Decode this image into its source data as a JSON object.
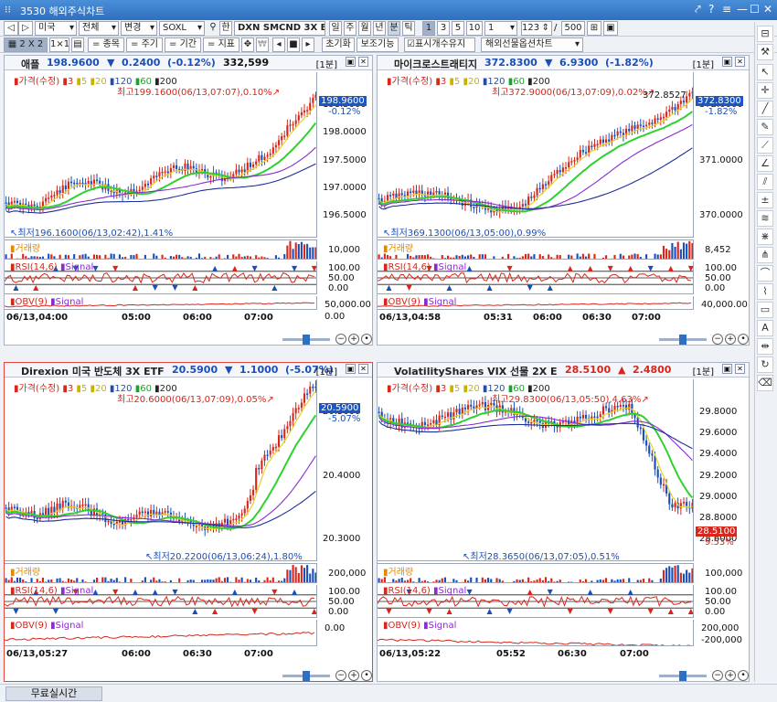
{
  "window": {
    "title": "3530 해외주식차트",
    "icons": [
      "link-icon",
      "help-icon",
      "menu-icon",
      "minimize-icon",
      "maximize-icon",
      "close-icon"
    ]
  },
  "toolbar1": {
    "market": "미국",
    "filter": "전체",
    "change": "변경",
    "symbol": "SOXL",
    "han": "한",
    "codes": "DXN SMCND 3X BL",
    "periods": [
      "일",
      "주",
      "월",
      "년",
      "분",
      "틱"
    ],
    "numbers": [
      "1",
      "3",
      "5",
      "10"
    ],
    "interval": "1",
    "count": "123",
    "slash": "/",
    "max": "500"
  },
  "toolbar2": {
    "layout": "2 X 2",
    "one": "1×1",
    "menus": [
      "= 종목",
      "= 주기",
      "= 기간",
      "= 지표"
    ],
    "reset": "초기화",
    "assist": "보조기능",
    "showcount": "표시개수유지",
    "futures": "해외선물옵션차트"
  },
  "panels": [
    {
      "name": "애플",
      "price": "198.9600",
      "arrow": "▼",
      "change": "0.2400",
      "pct": "(-0.12%)",
      "volume": "332,599",
      "interval": "[1분]",
      "direction": "down",
      "legend": {
        "price": "가격(수정)",
        "m3": "3",
        "m5": "5",
        "m20": "20",
        "m120": "120",
        "m60": "60",
        "m200": "200"
      },
      "high": "최고199.1600(06/13,07:07),0.10%",
      "low": "최저196.1600(06/13,02:42),1.41%",
      "ticks": [
        "198.5000",
        "198.0000",
        "197.5000",
        "197.0000",
        "196.5000"
      ],
      "tag": "198.9600",
      "tagpct": "-0.12%",
      "volume_label": "거래량",
      "volume_tick": "10,000",
      "rsi_label": "RSI(14,6)",
      "signal": "Signal",
      "rsi_ticks": [
        "100.00",
        "50.00",
        "0.00"
      ],
      "obv_label": "OBV(9)",
      "obv_ticks": [
        "50,000.00",
        "0.00"
      ],
      "xticks": [
        "06/13,04:00",
        "05:00",
        "06:00",
        "07:00"
      ]
    },
    {
      "name": "마이크로스트래티지",
      "price": "372.8300",
      "arrow": "▼",
      "change": "6.9300",
      "pct": "(-1.82%)",
      "volume": "",
      "interval": "[1분]",
      "direction": "down",
      "legend": {
        "price": "가격(수정)",
        "m3": "3",
        "m5": "5",
        "m20": "20",
        "m120": "120",
        "m60": "60",
        "m200": "200"
      },
      "high": "최고372.9000(06/13,07:09),0.02%",
      "low": "최저369.1300(06/13,05:00),0.99%",
      "lastlabel": "372.8527",
      "ticks": [
        "372.0000",
        "371.0000",
        "370.0000"
      ],
      "tag": "372.8300",
      "tagpct": "-1.82%",
      "volume_label": "거래량",
      "volume_tick": "8,452",
      "rsi_label": "RSI(14,6)",
      "signal": "Signal",
      "rsi_ticks": [
        "100.00",
        "50.00",
        "0.00"
      ],
      "obv_label": "OBV(9)",
      "obv_ticks": [
        "40,000.00"
      ],
      "xticks": [
        "06/13,04:58",
        "05:31",
        "06:00",
        "06:30",
        "07:00"
      ]
    },
    {
      "name": "Direxion 미국 반도체 3X ETF",
      "price": "20.5900",
      "arrow": "▼",
      "change": "1.1000",
      "pct": "(-5.07%)",
      "volume": "",
      "interval": "[1분]",
      "direction": "down",
      "legend": {
        "price": "가격(수정)",
        "m3": "3",
        "m5": "5",
        "m20": "20",
        "m120": "120",
        "m60": "60",
        "m200": "200"
      },
      "high": "최고20.6000(06/13,07:09),0.05%",
      "low": "최저20.2200(06/13,06:24),1.80%",
      "ticks": [
        "20.5000",
        "20.4000",
        "20.3000"
      ],
      "tag": "20.5900",
      "tagpct": "-5.07%",
      "volume_label": "거래량",
      "volume_tick": "200,000",
      "rsi_label": "RSI(14,6)",
      "signal": "Signal",
      "rsi_ticks": [
        "100.00",
        "50.00",
        "0.00"
      ],
      "obv_label": "OBV(9)",
      "obv_ticks": [
        "0.00"
      ],
      "xticks": [
        "06/13,05:27",
        "06:00",
        "06:30",
        "07:00"
      ]
    },
    {
      "name": "VolatilityShares VIX 선물 2X E",
      "price": "28.5100",
      "arrow": "▲",
      "change": "2.4800",
      "pct": "",
      "volume": "",
      "interval": "[1분]",
      "direction": "up",
      "legend": {
        "price": "가격(수정)",
        "m3": "3",
        "m5": "5",
        "m20": "20",
        "m120": "120",
        "m60": "60",
        "m200": "200"
      },
      "high": "최고29.8300(06/13,05:50),4.63%",
      "low": "최저28.3650(06/13,07:05),0.51%",
      "ticks": [
        "29.8000",
        "29.6000",
        "29.4000",
        "29.2000",
        "29.0000",
        "28.8000",
        "28.6000"
      ],
      "tag": "28.5100",
      "tagpct": "9.53%",
      "volume_label": "거래량",
      "volume_tick": "100,000",
      "rsi_label": "RSI(14,6)",
      "signal": "Signal",
      "rsi_ticks": [
        "100.00",
        "50.00",
        "0.00"
      ],
      "obv_label": "OBV(9)",
      "obv_ticks": [
        "200,000",
        "-200,000"
      ],
      "xticks": [
        "06/13,05:22",
        "05:52",
        "06:30",
        "07:00"
      ]
    }
  ],
  "statusbar": {
    "tab": "무료실시간"
  },
  "colors": {
    "up": "#d8261b",
    "down": "#1a4fb8",
    "ma5": "#e8d22a",
    "ma20": "#2fd12f",
    "ma60": "#8a2bd2",
    "ma120": "#1e2f9a"
  }
}
